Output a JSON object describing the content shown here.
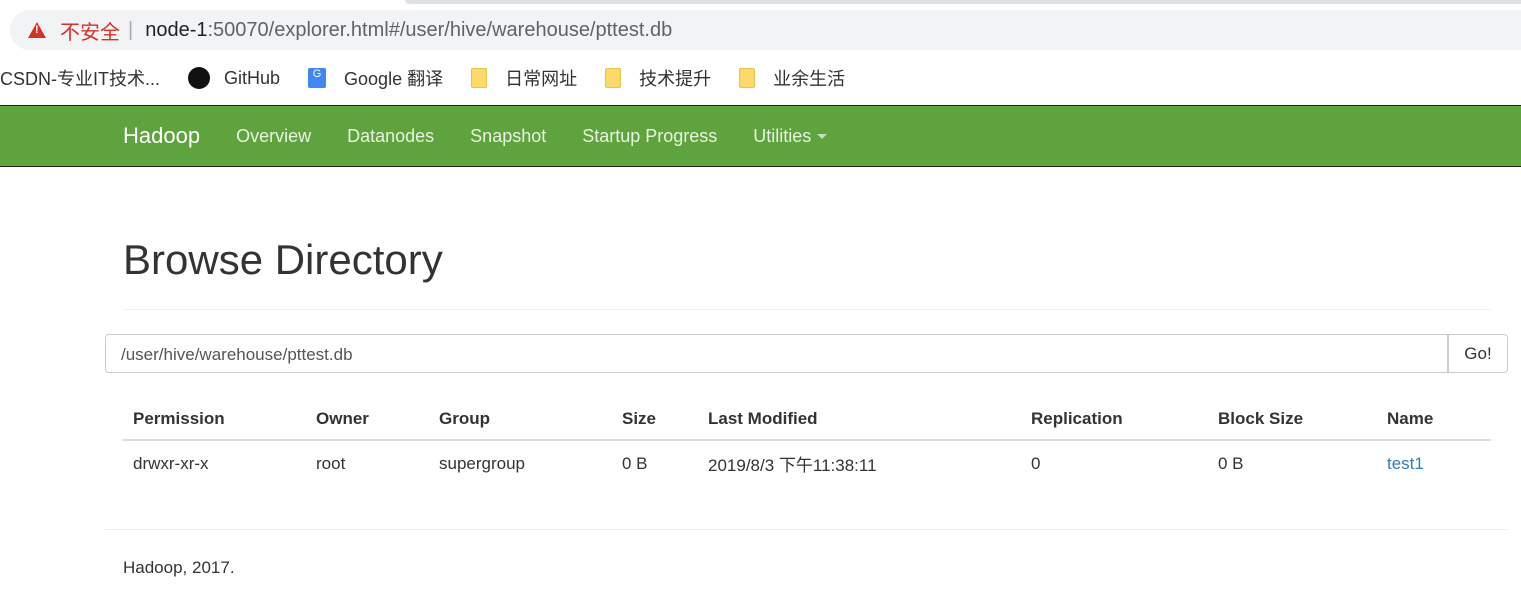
{
  "browser": {
    "insecure_label": "不安全",
    "url_host": "node-1",
    "url_path": ":50070/explorer.html#/user/hive/warehouse/pttest.db",
    "bookmarks": [
      {
        "label": "CSDN-专业IT技术...",
        "icon": "none"
      },
      {
        "label": "GitHub",
        "icon": "github-icon"
      },
      {
        "label": "Google 翻译",
        "icon": "google-translate-icon"
      },
      {
        "label": "日常网址",
        "icon": "folder-icon"
      },
      {
        "label": "技术提升",
        "icon": "folder-icon"
      },
      {
        "label": "业余生活",
        "icon": "folder-icon"
      }
    ]
  },
  "navbar": {
    "brand": "Hadoop",
    "items": [
      "Overview",
      "Datanodes",
      "Snapshot",
      "Startup Progress",
      "Utilities"
    ]
  },
  "main": {
    "title": "Browse Directory",
    "path_value": "/user/hive/warehouse/pttest.db",
    "go_label": "Go!",
    "columns": [
      "Permission",
      "Owner",
      "Group",
      "Size",
      "Last Modified",
      "Replication",
      "Block Size",
      "Name"
    ],
    "rows": [
      [
        "drwxr-xr-x",
        "root",
        "supergroup",
        "0 B",
        "2019/8/3 下午11:38:11",
        "0",
        "0 B",
        "test1"
      ]
    ]
  },
  "footer": {
    "text": "Hadoop, 2017."
  }
}
